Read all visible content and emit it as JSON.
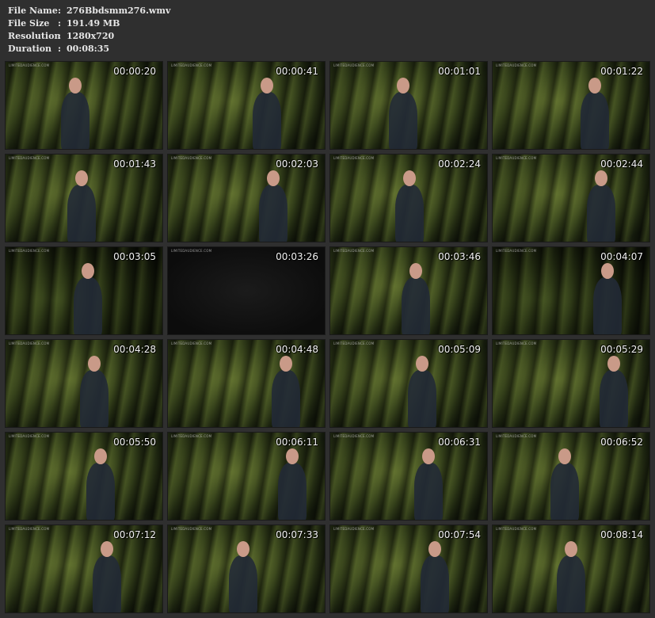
{
  "info": {
    "rows": [
      {
        "label": "File Name",
        "sep": ":",
        "value": "276Bbdsmm276.wmv"
      },
      {
        "label": "File Size",
        "sep": ":",
        "value": "191.49 MB"
      },
      {
        "label": "Resolution",
        "sep": ":",
        "value": "1280x720"
      },
      {
        "label": "Duration",
        "sep": ":",
        "value": "00:08:35"
      }
    ]
  },
  "watermark": "LIMITEDAUDIENCE.COM",
  "thumbnails": [
    {
      "time": "00:00:20"
    },
    {
      "time": "00:00:41"
    },
    {
      "time": "00:01:01"
    },
    {
      "time": "00:01:22"
    },
    {
      "time": "00:01:43"
    },
    {
      "time": "00:02:03"
    },
    {
      "time": "00:02:24"
    },
    {
      "time": "00:02:44"
    },
    {
      "time": "00:03:05"
    },
    {
      "time": "00:03:26"
    },
    {
      "time": "00:03:46"
    },
    {
      "time": "00:04:07"
    },
    {
      "time": "00:04:28"
    },
    {
      "time": "00:04:48"
    },
    {
      "time": "00:05:09"
    },
    {
      "time": "00:05:29"
    },
    {
      "time": "00:05:50"
    },
    {
      "time": "00:06:11"
    },
    {
      "time": "00:06:31"
    },
    {
      "time": "00:06:52"
    },
    {
      "time": "00:07:12"
    },
    {
      "time": "00:07:33"
    },
    {
      "time": "00:07:54"
    },
    {
      "time": "00:08:14"
    }
  ]
}
